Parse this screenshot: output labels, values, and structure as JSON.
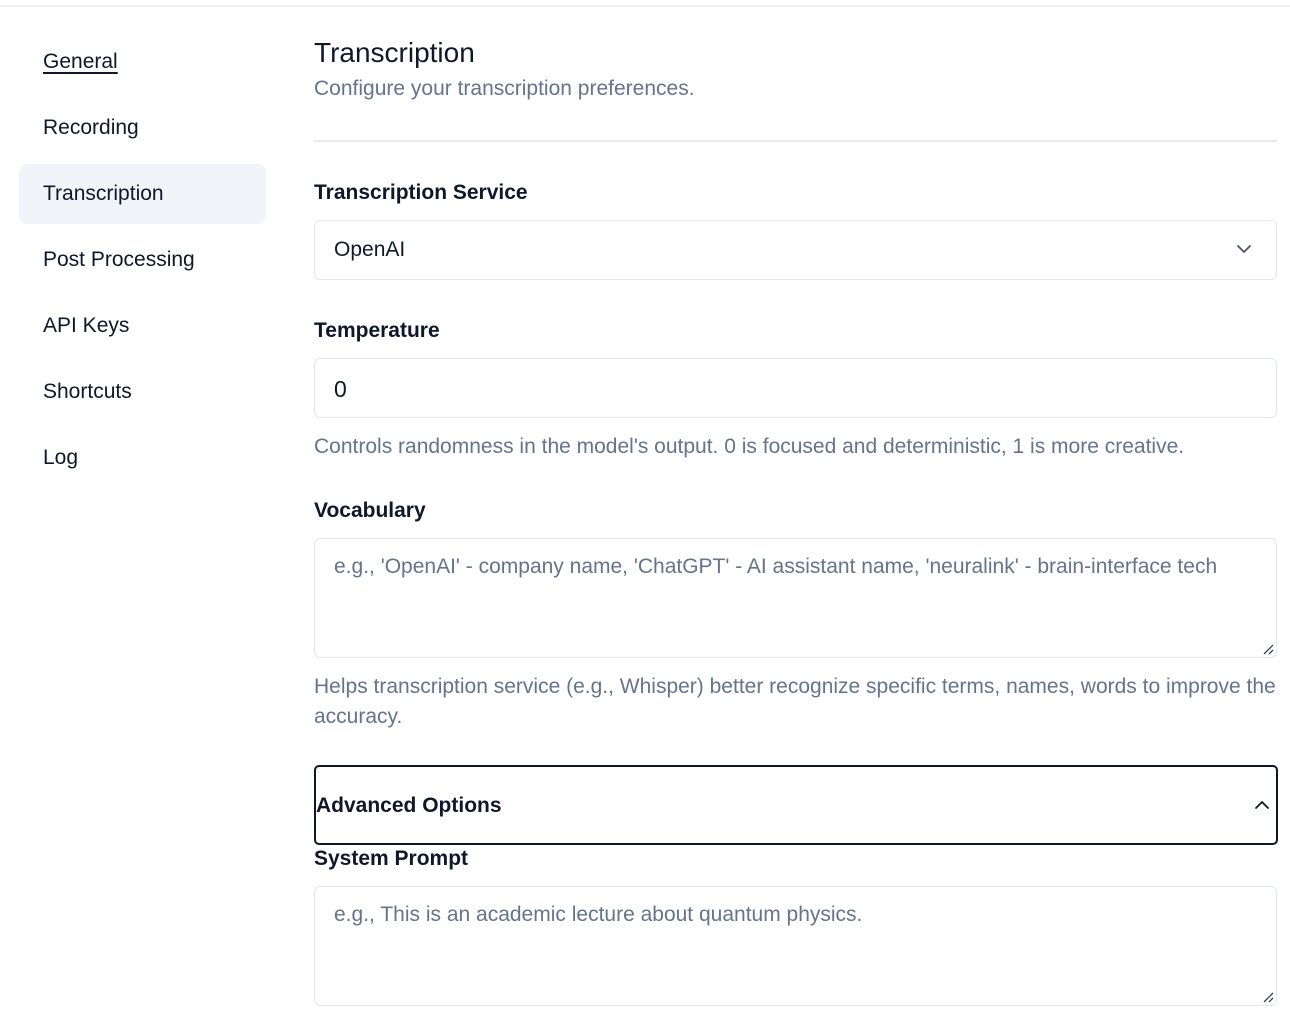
{
  "sidebar": {
    "items": [
      {
        "label": "General"
      },
      {
        "label": "Recording"
      },
      {
        "label": "Transcription"
      },
      {
        "label": "Post Processing"
      },
      {
        "label": "API Keys"
      },
      {
        "label": "Shortcuts"
      },
      {
        "label": "Log"
      }
    ],
    "active": "Transcription"
  },
  "main": {
    "title": "Transcription",
    "subtitle": "Configure your transcription preferences.",
    "service": {
      "label": "Transcription Service",
      "value": "OpenAI"
    },
    "temperature": {
      "label": "Temperature",
      "value": "0",
      "help": "Controls randomness in the model's output. 0 is focused and deterministic, 1 is more creative."
    },
    "vocabulary": {
      "label": "Vocabulary",
      "placeholder": "e.g., 'OpenAI' - company name, 'ChatGPT' - AI assistant name, 'neuralink' - brain-interface tech",
      "help": "Helps transcription service (e.g., Whisper) better recognize specific terms, names, words to improve the accuracy."
    },
    "advanced": {
      "label": "Advanced Options",
      "expanded": true
    },
    "system_prompt": {
      "label": "System Prompt",
      "placeholder": "e.g., This is an academic lecture about quantum physics."
    }
  },
  "icons": {
    "service_dropdown": "chevron-down-icon",
    "advanced_toggle": "chevron-up-icon",
    "textarea_resize": "resize-handle-icon"
  },
  "colors": {
    "text": "#0f172a",
    "muted": "#64748b",
    "border": "#e2e8f0",
    "active_nav_bg": "#f1f4f8"
  }
}
